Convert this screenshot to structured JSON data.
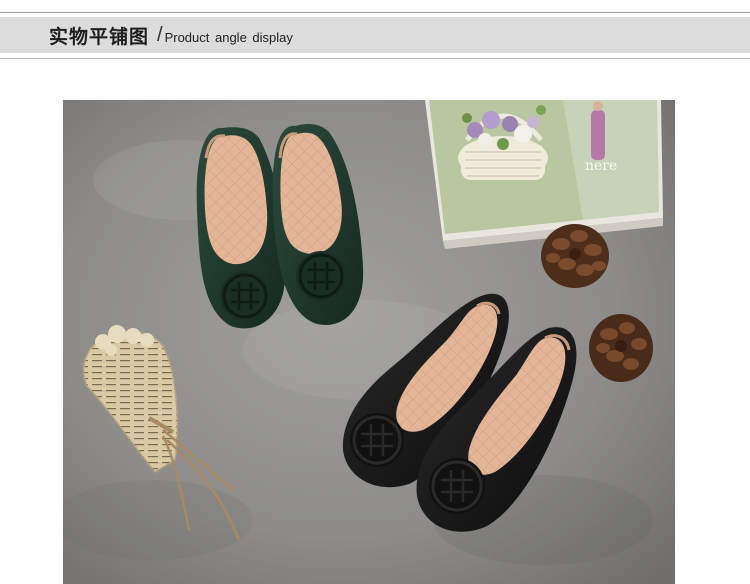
{
  "header": {
    "title_cn": "实物平铺图",
    "slash": "/",
    "title_en": "Product angle display"
  },
  "colors": {
    "band": "#dcdcdc",
    "floor": "#8e8e8c",
    "shoe_green": "#1f3a30",
    "shoe_black": "#151515",
    "insole": "#e3b79a"
  },
  "photo": {
    "subject": "product-photo-ballet-flats",
    "book_text": "nere"
  }
}
